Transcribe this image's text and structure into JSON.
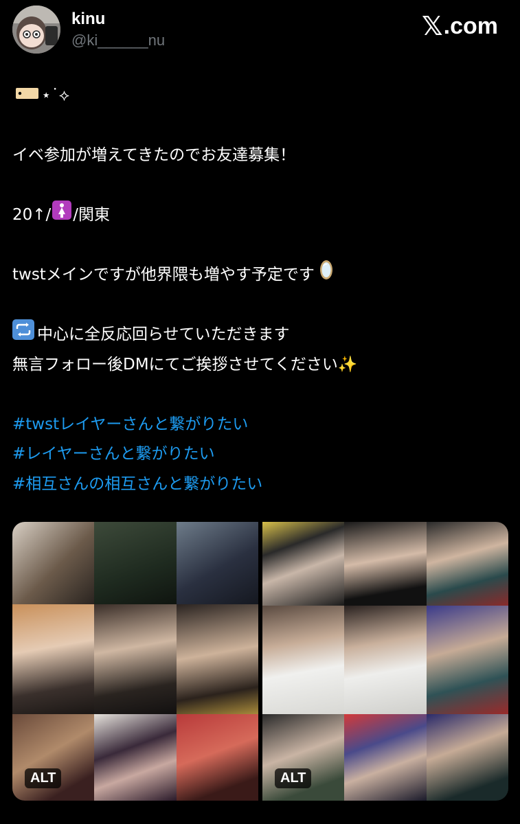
{
  "header": {
    "display_name": "kinu",
    "handle": "@ki______nu",
    "brand_label": ".com"
  },
  "tweet": {
    "line1": "⋆˙⟡",
    "line2": "イベ参加が増えてきたのでお友達募集！",
    "line3a": "20↑/",
    "line3b": "/関東",
    "line4": "twstメインですが他界隈も増やす予定です",
    "line5": "中心に全反応回らせていただきます",
    "line6": "無言フォロー後DMにてご挨拶させてください✨",
    "hashtags": [
      "#twstレイヤーさんと繋がりたい",
      "#レイヤーさんと繋がりたい",
      "#相互さんの相互さんと繋がりたい"
    ]
  },
  "media": {
    "items": [
      {
        "alt_label": "ALT"
      },
      {
        "alt_label": "ALT"
      }
    ]
  },
  "colors": {
    "background": "#000000",
    "text": "#ffffff",
    "secondary": "#71767b",
    "link": "#1d9bf0"
  },
  "icons": {
    "label_tag": "label-tag-icon",
    "restroom_female": "restroom-woman-icon",
    "mirror": "mirror-icon",
    "repeat": "repeat-arrows-icon",
    "brand": "x-logo-icon"
  }
}
